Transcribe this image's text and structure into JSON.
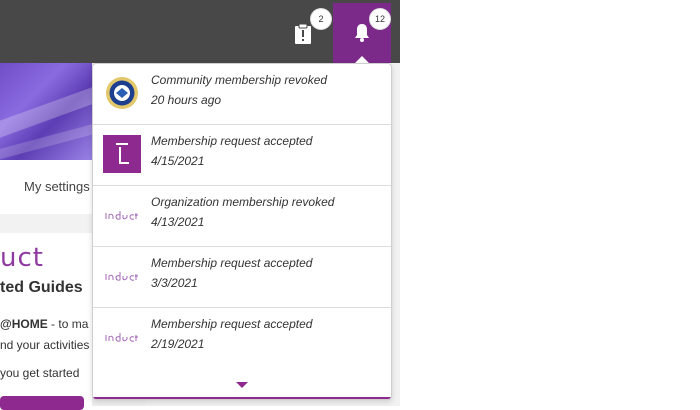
{
  "topbar": {
    "clipboard_badge": "2",
    "notifications_badge": "12"
  },
  "background_page": {
    "settings_label": "My settings",
    "brand_partial": "uct",
    "guides_partial": "ted Guides",
    "home_partial_bold": "@HOME",
    "home_partial_rest": " - to ma",
    "activities_partial": "nd your activities",
    "started_partial": "you get started"
  },
  "notifications": [
    {
      "title": "Community membership revoked",
      "time": "20 hours ago",
      "avatar": "seal-logo"
    },
    {
      "title": "Membership request accepted",
      "time": "4/15/2021",
      "avatar": "purple-l-logo"
    },
    {
      "title": "Organization membership revoked",
      "time": "4/13/2021",
      "avatar": "induct-logo"
    },
    {
      "title": "Membership request accepted",
      "time": "3/3/2021",
      "avatar": "induct-logo"
    },
    {
      "title": "Membership request accepted",
      "time": "2/19/2021",
      "avatar": "induct-logo"
    }
  ],
  "colors": {
    "topbar": "#484848",
    "accent": "#8e2a8f",
    "bell_bg": "#7b2a8a"
  }
}
